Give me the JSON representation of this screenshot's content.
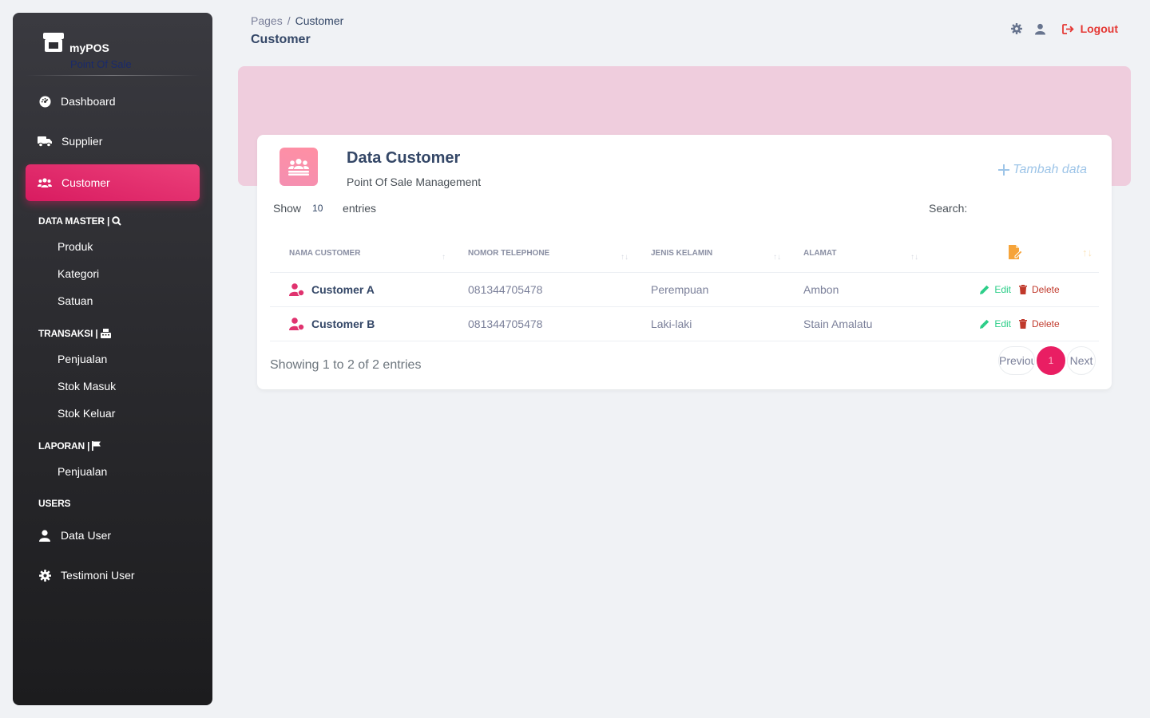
{
  "brand": {
    "name": "myPOS",
    "subtitle": "Point Of Sale"
  },
  "sidebar": {
    "top_items": [
      {
        "label": "Dashboard",
        "icon": "dashboard-icon"
      },
      {
        "label": "Supplier",
        "icon": "truck-icon"
      },
      {
        "label": "Customer",
        "icon": "users-icon",
        "active": true
      }
    ],
    "sections": [
      {
        "title": "DATA MASTER |",
        "icon": "search-icon",
        "items": [
          "Produk",
          "Kategori",
          "Satuan"
        ]
      },
      {
        "title": "TRANSAKSI |",
        "icon": "cash-register-icon",
        "items": [
          "Penjualan",
          "Stok Masuk",
          "Stok Keluar"
        ]
      },
      {
        "title": "LAPORAN |",
        "icon": "flag-icon",
        "items": [
          "Penjualan"
        ]
      },
      {
        "title": "USERS",
        "icon": "",
        "items": []
      }
    ],
    "bottom_items": [
      {
        "label": "Data User",
        "icon": "user-icon"
      },
      {
        "label": "Testimoni User",
        "icon": "gear-icon"
      }
    ]
  },
  "header": {
    "breadcrumb": [
      "Pages",
      "Customer"
    ],
    "separator": "/",
    "title": "Customer",
    "logout_label": "Logout"
  },
  "card": {
    "title": "Data Customer",
    "subtitle": "Point Of Sale Management",
    "add_label": "Tambah data",
    "show_label": "Show",
    "page_size": "10",
    "entries_label": "entries",
    "search_label": "Search:"
  },
  "table": {
    "columns": [
      "NAMA CUSTOMER",
      "NOMOR TELEPHONE",
      "JENIS KELAMIN",
      "ALAMAT"
    ],
    "rows": [
      {
        "name": "Customer A",
        "phone": "081344705478",
        "gender": "Perempuan",
        "address": "Ambon"
      },
      {
        "name": "Customer B",
        "phone": "081344705478",
        "gender": "Laki-laki",
        "address": "Stain Amalatu"
      }
    ],
    "edit_label": "Edit",
    "delete_label": "Delete"
  },
  "footer": {
    "info": "Showing 1 to 2 of 2 entries",
    "prev_label": "Previous",
    "current_page": "1",
    "next_label": "Next"
  },
  "colors": {
    "accent": "#e91e63",
    "banner": "#efcddd",
    "logout": "#e53935",
    "edit": "#2dce89",
    "delete": "#c0392b"
  }
}
